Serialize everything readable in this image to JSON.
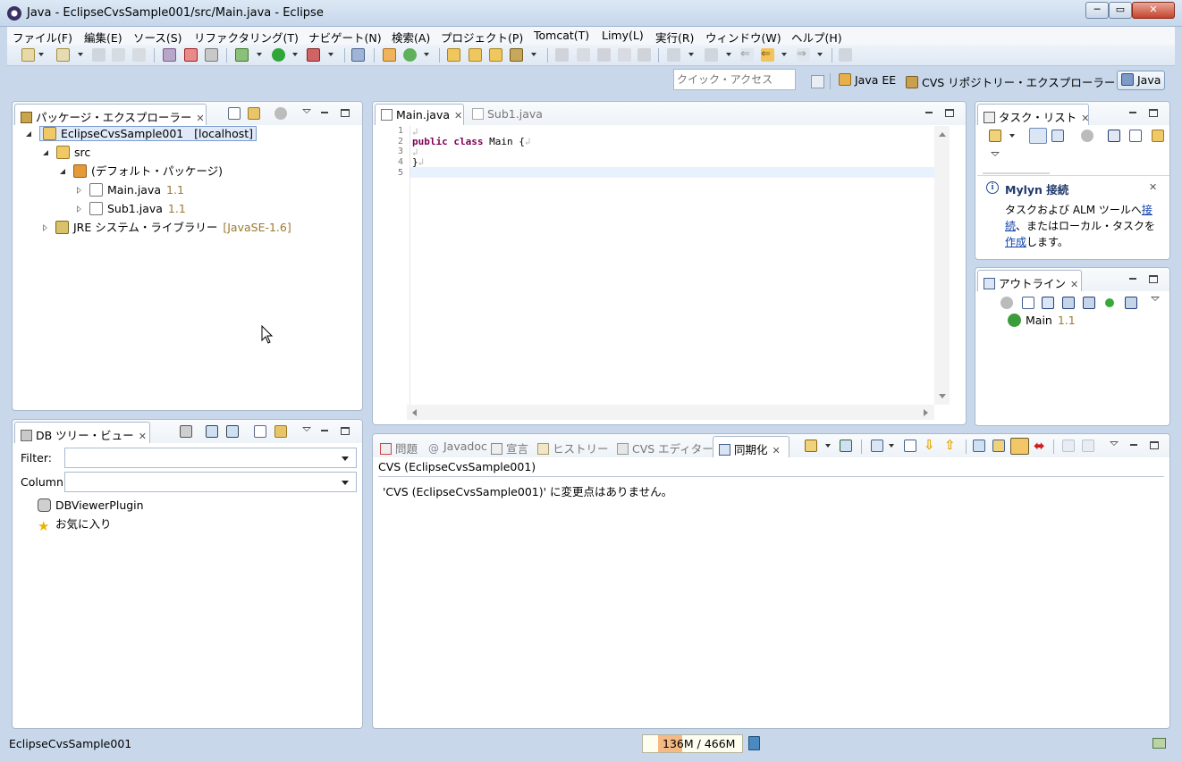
{
  "window": {
    "title": "Java - EclipseCvsSample001/src/Main.java - Eclipse",
    "minimize_label": "─",
    "maximize_label": "▭",
    "close_label": "✕"
  },
  "menu": [
    {
      "label": "ファイル(F)"
    },
    {
      "label": "編集(E)"
    },
    {
      "label": "ソース(S)"
    },
    {
      "label": "リファクタリング(T)"
    },
    {
      "label": "ナビゲート(N)"
    },
    {
      "label": "検索(A)"
    },
    {
      "label": "プロジェクト(P)"
    },
    {
      "label": "Tomcat(T)"
    },
    {
      "label": "Limy(L)"
    },
    {
      "label": "実行(R)"
    },
    {
      "label": "ウィンドウ(W)"
    },
    {
      "label": "ヘルプ(H)"
    }
  ],
  "quick_access": {
    "placeholder": "クイック・アクセス"
  },
  "perspectives": [
    {
      "label": "Java EE"
    },
    {
      "label": "CVS リポジトリー・エクスプローラー"
    },
    {
      "label": "Java"
    }
  ],
  "package_explorer": {
    "tab_label": "パッケージ・エクスプローラー",
    "tree": {
      "project": {
        "label": "EclipseCvsSample001",
        "host": "[localhost]"
      },
      "src": "src",
      "default_package": "(デフォルト・パッケージ)",
      "files": [
        {
          "label": "Main.java",
          "rev": "1.1"
        },
        {
          "label": "Sub1.java",
          "rev": "1.1"
        }
      ],
      "jre": {
        "label": "JRE システム・ライブラリー",
        "version": "[JavaSE-1.6]"
      }
    }
  },
  "db_tree": {
    "tab_label": "DB ツリー・ビュー",
    "filter_label": "Filter:",
    "column_label": "Column:",
    "items": [
      {
        "label": "DBViewerPlugin"
      },
      {
        "label": "お気に入り"
      }
    ]
  },
  "editor": {
    "tabs": [
      {
        "label": "Main.java"
      },
      {
        "label": "Sub1.java"
      }
    ],
    "line_numbers": [
      "1",
      "2",
      "3",
      "4",
      "5"
    ],
    "code": {
      "kw1": "public",
      "kw2": "class",
      "rest": " Main {",
      "close": "}",
      "eol": "↲"
    }
  },
  "task_list": {
    "tab_label": "タスク・リスト",
    "mylyn_title": "Mylyn 接続",
    "mylyn_text_1": "タスクおよび ALM ツールへ",
    "mylyn_link_1a": "接",
    "mylyn_link_1b": "続",
    "mylyn_text_2": "、またはローカル・タスクを",
    "mylyn_link_2": "作成",
    "mylyn_text_3": "します。"
  },
  "outline": {
    "tab_label": "アウトライン",
    "items": [
      {
        "label": "Main",
        "rev": "1.1"
      }
    ]
  },
  "bottom_views": {
    "tabs": [
      {
        "label": "問題"
      },
      {
        "label": "Javadoc"
      },
      {
        "label": "宣言"
      },
      {
        "label": "ヒストリー"
      },
      {
        "label": "CVS エディター"
      },
      {
        "label": "同期化"
      }
    ],
    "sync_header": "CVS (EclipseCvsSample001)",
    "sync_message": "'CVS (EclipseCvsSample001)' に変更点はありません。"
  },
  "status": {
    "left_text": "EclipseCvsSample001",
    "heap_used": "136M",
    "heap_sep": " / ",
    "heap_total": "466M",
    "heap_used_fraction": 0.29
  },
  "colors": {
    "accent": "#7f0055",
    "link": "#0b3fa8",
    "revision": "#9a7a32",
    "heap_fill": "#f5b983"
  }
}
